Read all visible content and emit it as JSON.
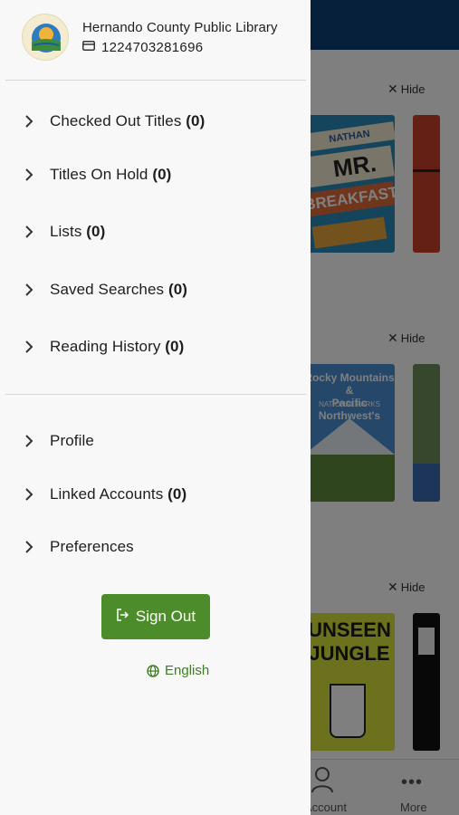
{
  "library": {
    "name": "Hernando County Public Library",
    "card_number": "1224703281696",
    "logo_text": "HERNANDO COUNTY FLORIDA"
  },
  "menu": {
    "section1": [
      {
        "label": "Checked Out Titles",
        "count": "(0)"
      },
      {
        "label": "Titles On Hold",
        "count": "(0)"
      },
      {
        "label": "Lists",
        "count": "(0)"
      },
      {
        "label": "Saved Searches",
        "count": "(0)"
      },
      {
        "label": "Reading History",
        "count": "(0)"
      }
    ],
    "section2": [
      {
        "label": "Profile",
        "count": ""
      },
      {
        "label": "Linked Accounts",
        "count": "(0)"
      },
      {
        "label": "Preferences",
        "count": ""
      }
    ]
  },
  "sign_out_label": "Sign Out",
  "language_label": "English",
  "background": {
    "hide_label": "Hide",
    "covers": {
      "book1_author": "NATHAN CARROLL",
      "book1_title_a": "MR.",
      "book1_title_b": "BREAKFAST",
      "book2_title_a": "Rocky Mountains &",
      "book2_title_b": "Pacific Northwest's",
      "book2_subtitle": "NATIONAL PARKS",
      "book3_title_a": "UNSEEN",
      "book3_title_b": "JUNGLE"
    },
    "tabs": {
      "account": "Account",
      "more": "More"
    }
  },
  "colors": {
    "accent_green": "#4d8c2a",
    "nav_blue": "#0d3e74"
  }
}
